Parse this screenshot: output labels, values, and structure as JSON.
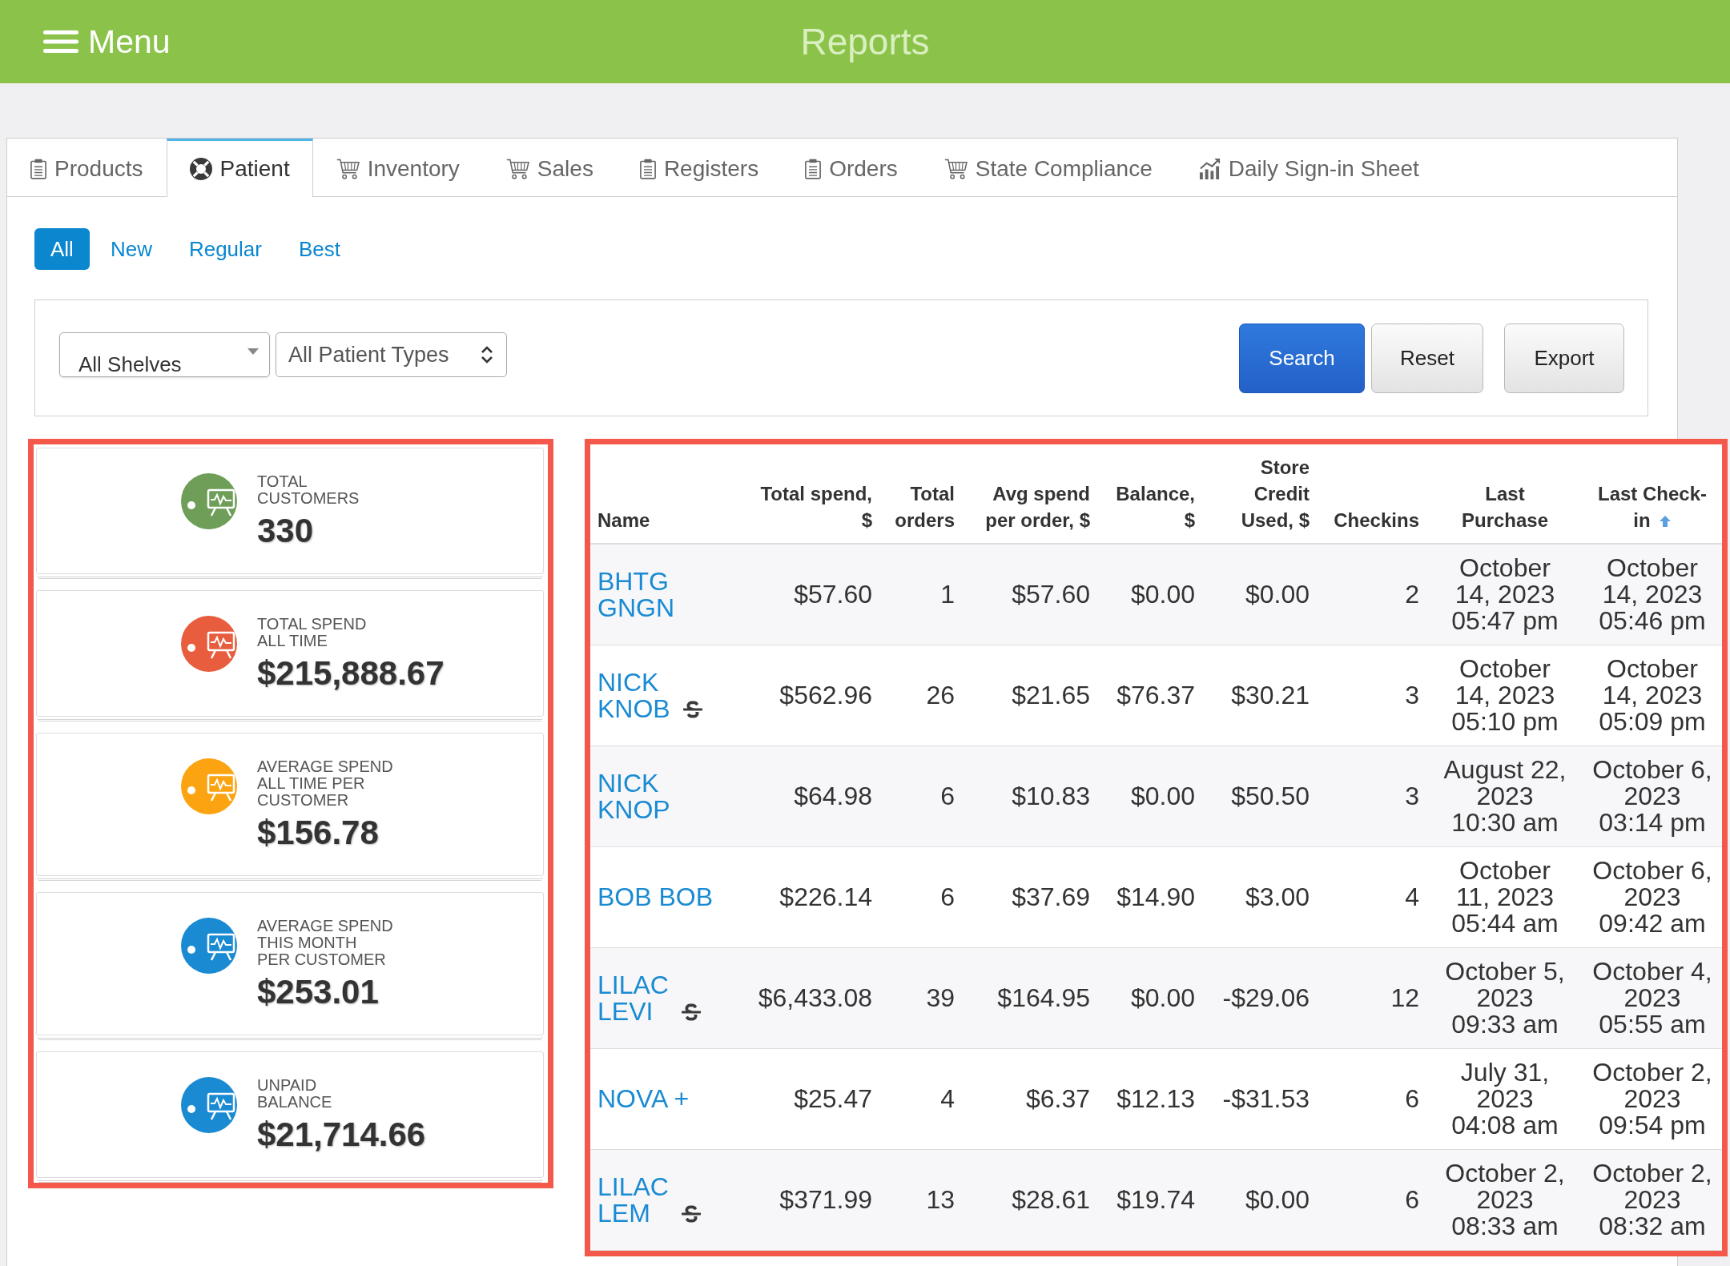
{
  "header": {
    "menu_label": "Menu",
    "title": "Reports"
  },
  "tabs": [
    {
      "label": "Products",
      "selected": false
    },
    {
      "label": "Patient",
      "selected": true
    },
    {
      "label": "Inventory",
      "selected": false
    },
    {
      "label": "Sales",
      "selected": false
    },
    {
      "label": "Registers",
      "selected": false
    },
    {
      "label": "Orders",
      "selected": false
    },
    {
      "label": "State Compliance",
      "selected": false
    },
    {
      "label": "Daily Sign-in Sheet",
      "selected": false
    }
  ],
  "patient_filters": [
    {
      "label": "All",
      "selected": true
    },
    {
      "label": "New",
      "selected": false
    },
    {
      "label": "Regular",
      "selected": false
    },
    {
      "label": "Best",
      "selected": false
    }
  ],
  "search_form": {
    "shelf_select": {
      "value": "All Shelves"
    },
    "patient_type_select": {
      "value": "All Patient Types"
    },
    "buttons": [
      {
        "label": "Search",
        "kind": "primary"
      },
      {
        "label": "Reset",
        "kind": "default"
      },
      {
        "label": "Export",
        "kind": "default"
      }
    ]
  },
  "summary_cards": [
    {
      "label_lines": [
        "TOTAL",
        "CUSTOMERS"
      ],
      "value": "330",
      "color": "#6e9e58"
    },
    {
      "label_lines": [
        "TOTAL SPEND",
        "ALL TIME"
      ],
      "value": "$215,888.67",
      "color": "#e85d3d"
    },
    {
      "label_lines": [
        "AVERAGE SPEND",
        "ALL TIME PER",
        "CUSTOMER"
      ],
      "value": "$156.78",
      "color": "#fca311"
    },
    {
      "label_lines": [
        "AVERAGE SPEND",
        "THIS MONTH",
        "PER CUSTOMER"
      ],
      "value": "$253.01",
      "color": "#1a8bd3"
    },
    {
      "label_lines": [
        "UNPAID",
        "BALANCE"
      ],
      "value": "$21,714.66",
      "color": "#1a8bd3"
    }
  ],
  "table": {
    "columns": [
      {
        "label": "Name",
        "sorted": false
      },
      {
        "label": "Total spend, $",
        "sorted": false
      },
      {
        "label": "Total orders",
        "sorted": false
      },
      {
        "label": "Avg spend per order, $",
        "sorted": false
      },
      {
        "label": "Balance, $",
        "sorted": false
      },
      {
        "label": "Store Credit Used, $",
        "sorted": false
      },
      {
        "label": "Checkins",
        "sorted": false
      },
      {
        "label": "Last Purchase",
        "sorted": false
      },
      {
        "label": "Last Check-in",
        "sorted": true
      }
    ],
    "rows": [
      {
        "s_icon": false,
        "cells": [
          "BHTG GNGN",
          "$57.60",
          "1",
          "$57.60",
          "$0.00",
          "$0.00",
          "2",
          "October 14, 2023 05:47 pm",
          "October 14, 2023 05:46 pm"
        ]
      },
      {
        "s_icon": true,
        "cells": [
          "NICK KNOB",
          "$562.96",
          "26",
          "$21.65",
          "$76.37",
          "$30.21",
          "3",
          "October 14, 2023 05:10 pm",
          "October 14, 2023 05:09 pm"
        ]
      },
      {
        "s_icon": false,
        "cells": [
          "NICK KNOP",
          "$64.98",
          "6",
          "$10.83",
          "$0.00",
          "$50.50",
          "3",
          "August 22, 2023 10:30 am",
          "October 6, 2023 03:14 pm"
        ]
      },
      {
        "s_icon": false,
        "cells": [
          "BOB BOB",
          "$226.14",
          "6",
          "$37.69",
          "$14.90",
          "$3.00",
          "4",
          "October 11, 2023 05:44 am",
          "October 6, 2023 09:42 am"
        ]
      },
      {
        "s_icon": true,
        "cells": [
          "LILAC LEVI",
          "$6,433.08",
          "39",
          "$164.95",
          "$0.00",
          "-$29.06",
          "12",
          "October 5, 2023 09:33 am",
          "October 4, 2023 05:55 am"
        ]
      },
      {
        "s_icon": false,
        "cells": [
          "NOVA +",
          "$25.47",
          "4",
          "$6.37",
          "$12.13",
          "-$31.53",
          "6",
          "July 31, 2023 04:08 am",
          "October 2, 2023 09:54 pm"
        ]
      },
      {
        "s_icon": true,
        "cells": [
          "LILAC LEM",
          "$371.99",
          "13",
          "$28.61",
          "$19.74",
          "$0.00",
          "6",
          "October 2, 2023 08:33 am",
          "October 2, 2023 08:32 am"
        ]
      }
    ]
  }
}
